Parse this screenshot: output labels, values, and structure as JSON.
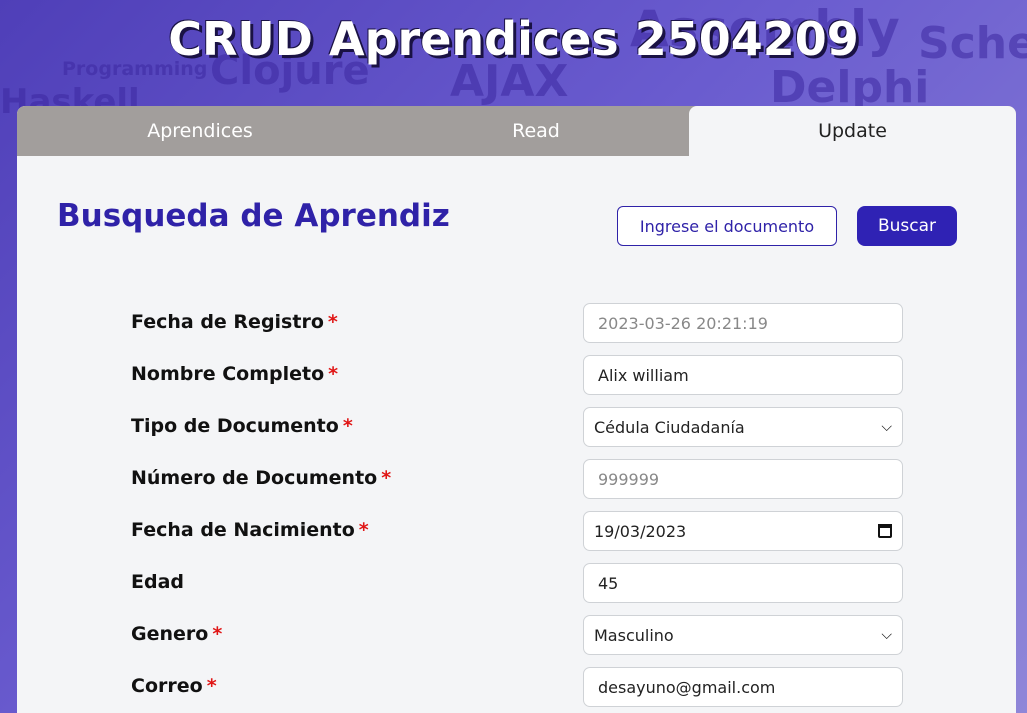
{
  "page": {
    "title": "CRUD Aprendices 2504209"
  },
  "background_words": [
    "Programming",
    "Clojure",
    "AJAX",
    "Assembly",
    "Scheme",
    "Delphi",
    "Haskell"
  ],
  "tabs": [
    {
      "label": "Aprendices",
      "active": false
    },
    {
      "label": "Read",
      "active": false
    },
    {
      "label": "Update",
      "active": true
    }
  ],
  "search": {
    "heading": "Busqueda de Aprendiz",
    "placeholder": "Ingrese el documento",
    "button_label": "Buscar"
  },
  "required_mark": "*",
  "form": {
    "fecha_registro": {
      "label": "Fecha de Registro",
      "required": true,
      "value": "2023-03-26 20:21:19"
    },
    "nombre": {
      "label": "Nombre Completo",
      "required": true,
      "value": "Alix william"
    },
    "tipo_documento": {
      "label": "Tipo de Documento",
      "required": true,
      "value": "Cédula Ciudadanía"
    },
    "numero_documento": {
      "label": "Número de Documento",
      "required": true,
      "value": "999999"
    },
    "fecha_nacimiento": {
      "label": "Fecha de Nacimiento",
      "required": true,
      "value": "19/03/2023"
    },
    "edad": {
      "label": "Edad",
      "required": false,
      "value": "45"
    },
    "genero": {
      "label": "Genero",
      "required": true,
      "value": "Masculino"
    },
    "correo": {
      "label": "Correo",
      "required": true,
      "value": "desayuno@gmail.com"
    }
  },
  "colors": {
    "accent": "#2f22a8",
    "required": "#e01616",
    "tab_inactive": "#a29e9c",
    "card_bg": "#f4f5f7"
  }
}
